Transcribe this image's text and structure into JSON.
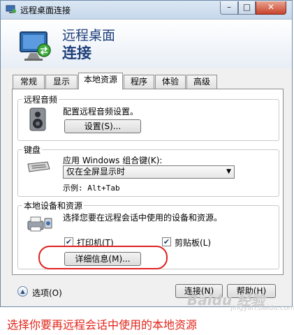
{
  "window": {
    "title": "远程桌面连接",
    "controls": {
      "minimize": "–",
      "maximize": "□",
      "close": "✕"
    }
  },
  "header": {
    "line1": "远程桌面",
    "line2": "连接"
  },
  "tabs": [
    {
      "label": "常规"
    },
    {
      "label": "显示"
    },
    {
      "label": "本地资源",
      "active": true
    },
    {
      "label": "程序"
    },
    {
      "label": "体验"
    },
    {
      "label": "高级"
    }
  ],
  "audio": {
    "group_label": "远程音频",
    "description": "配置远程音频设置。",
    "button_label": "设置(S)..."
  },
  "keyboard": {
    "group_label": "键盘",
    "description": "应用 Windows 组合键(K):",
    "selected_option": "仅在全屏显示时",
    "example_label": "示例: Alt+Tab"
  },
  "local_devices": {
    "group_label": "本地设备和资源",
    "description": "选择您要在远程会话中使用的设备和资源。",
    "printer": {
      "label": "打印机(T)",
      "checked": true
    },
    "clipboard": {
      "label": "剪贴板(L)",
      "checked": true
    },
    "details_button": "详细信息(M)..."
  },
  "footer": {
    "options_label": "选项(O)",
    "connect_button": "连接(N)",
    "help_button": "帮助(H)"
  },
  "caption": "选择你要再远程会话中使用的本地资源",
  "watermark": {
    "text": "Baidu 经验",
    "subtext": "jingyan.baidu.com"
  },
  "colors": {
    "annotation_red": "#e1251b",
    "title_blue": "#1e3f7a"
  }
}
